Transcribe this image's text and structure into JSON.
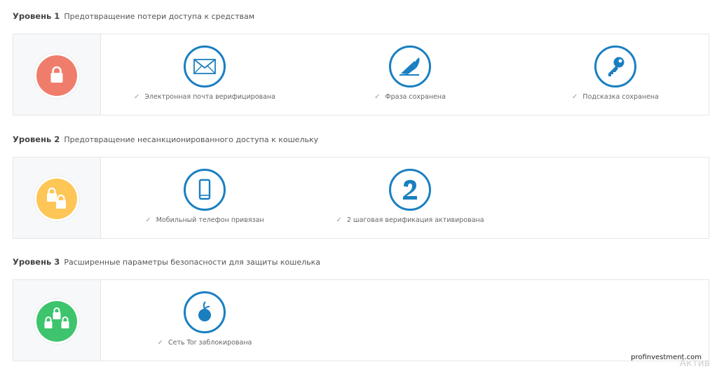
{
  "levels": [
    {
      "number_label": "Уровень 1",
      "description": "Предотвращение потери доступа к средствам",
      "badge_color": "#f07d6b",
      "items": [
        {
          "icon": "envelope-icon",
          "label": "Электронная почта верифицирована"
        },
        {
          "icon": "quill-pen-icon",
          "label": "Фраза сохранена"
        },
        {
          "icon": "key-icon",
          "label": "Подсказка сохранена"
        }
      ]
    },
    {
      "number_label": "Уровень 2",
      "description": "Предотвращение несанкционированного доступа к кошельку",
      "badge_color": "#fec656",
      "items": [
        {
          "icon": "mobile-phone-icon",
          "label": "Мобильный телефон привязан"
        },
        {
          "icon": "number-two-icon",
          "label": "2 шаговая верификация активирована"
        }
      ]
    },
    {
      "number_label": "Уровень 3",
      "description": "Расширенные параметры безопасности для защиты кошелька",
      "badge_color": "#3dc46d",
      "items": [
        {
          "icon": "tor-onion-icon",
          "label": "Сеть Tor заблокирована"
        }
      ]
    }
  ],
  "check_mark": "✓",
  "icon_color": "#1a7fc1",
  "watermark": "profinvestment.com",
  "faded_text": "Актив"
}
